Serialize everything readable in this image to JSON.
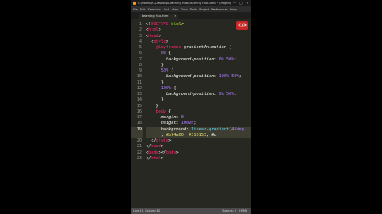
{
  "window": {
    "title": "C:\\Users\\PC\\Desktop\\Learning Hub\\Learning Hub.html • (Project) - Sublime Text",
    "minimize": "—",
    "maximize": "▢",
    "close": "✕"
  },
  "menu": [
    "File",
    "Edit",
    "Selection",
    "Find",
    "View",
    "Goto",
    "Tools",
    "Project",
    "Preferences",
    "Help"
  ],
  "tab": {
    "label": "Learning Hub.html",
    "close": "✕"
  },
  "logo_text": "</>",
  "editor": {
    "current_line": 19,
    "lines": [
      {
        "n": "1",
        "segs": [
          [
            "p",
            "<!"
          ],
          [
            "t",
            "DOCTYPE"
          ],
          [
            "a",
            " html"
          ],
          [
            "p",
            ">"
          ]
        ]
      },
      {
        "n": "2",
        "segs": [
          [
            "p",
            "<"
          ],
          [
            "t",
            "html"
          ],
          [
            "p",
            ">"
          ]
        ]
      },
      {
        "n": "3",
        "segs": [
          [
            "p",
            "<"
          ],
          [
            "t",
            "head"
          ],
          [
            "p",
            ">"
          ]
        ]
      },
      {
        "n": "4",
        "segs": [
          [
            "p",
            "  <"
          ],
          [
            "t",
            "style"
          ],
          [
            "p",
            ">"
          ]
        ]
      },
      {
        "n": "5",
        "segs": [
          [
            "p",
            "    "
          ],
          [
            "t",
            "@keyframes"
          ],
          [
            "p",
            " gradientAnimation {"
          ]
        ]
      },
      {
        "n": "6",
        "segs": [
          [
            "p",
            "      "
          ],
          [
            "n",
            "0%"
          ],
          [
            "p",
            " {"
          ]
        ]
      },
      {
        "n": "7",
        "segs": [
          [
            "p",
            "        "
          ],
          [
            "pr",
            "background-position"
          ],
          [
            "p",
            ": "
          ],
          [
            "n",
            "0% 50%"
          ],
          [
            "p",
            ";"
          ]
        ]
      },
      {
        "n": "8",
        "segs": [
          [
            "p",
            "      }"
          ]
        ]
      },
      {
        "n": "9",
        "segs": [
          [
            "p",
            "      "
          ],
          [
            "n",
            "50%"
          ],
          [
            "p",
            " {"
          ]
        ]
      },
      {
        "n": "10",
        "segs": [
          [
            "p",
            "        "
          ],
          [
            "pr",
            "background-position"
          ],
          [
            "p",
            ": "
          ],
          [
            "n",
            "100% 50%"
          ],
          [
            "p",
            ";"
          ]
        ]
      },
      {
        "n": "11",
        "segs": [
          [
            "p",
            "      }"
          ]
        ]
      },
      {
        "n": "12",
        "segs": [
          [
            "p",
            "      "
          ],
          [
            "n",
            "100%"
          ],
          [
            "p",
            " {"
          ]
        ]
      },
      {
        "n": "13",
        "segs": [
          [
            "p",
            "        "
          ],
          [
            "pr",
            "background-position"
          ],
          [
            "p",
            ": "
          ],
          [
            "n",
            "0% 50%"
          ],
          [
            "p",
            ";"
          ]
        ]
      },
      {
        "n": "14",
        "segs": [
          [
            "p",
            "      }"
          ]
        ]
      },
      {
        "n": "15",
        "segs": [
          [
            "p",
            "    }"
          ]
        ]
      },
      {
        "n": "16",
        "segs": [
          [
            "p",
            "    "
          ],
          [
            "t",
            "body"
          ],
          [
            "p",
            " {"
          ]
        ]
      },
      {
        "n": "17",
        "segs": [
          [
            "p",
            "      "
          ],
          [
            "pr",
            "margin"
          ],
          [
            "p",
            ": "
          ],
          [
            "n",
            "0"
          ],
          [
            "p",
            ";"
          ]
        ]
      },
      {
        "n": "18",
        "segs": [
          [
            "p",
            "      "
          ],
          [
            "pr",
            "height"
          ],
          [
            "p",
            ": "
          ],
          [
            "n",
            "100vh"
          ],
          [
            "p",
            ";"
          ]
        ]
      },
      {
        "n": "19",
        "segs": [
          [
            "p",
            "      "
          ],
          [
            "pr",
            "background"
          ],
          [
            "p",
            ": "
          ],
          [
            "f",
            "linear-gradient"
          ],
          [
            "p",
            "("
          ],
          [
            "n",
            "45deg"
          ]
        ]
      },
      {
        "n": "",
        "segs": [
          [
            "p",
            "      , "
          ],
          [
            "s",
            "#b94a00"
          ],
          [
            "p",
            ", "
          ],
          [
            "s",
            "#310153"
          ],
          [
            "p",
            ", #c"
          ]
        ]
      },
      {
        "n": "20",
        "segs": [
          [
            "p",
            "  </"
          ],
          [
            "t",
            "style"
          ],
          [
            "p",
            ">"
          ]
        ]
      },
      {
        "n": "21",
        "segs": [
          [
            "p",
            "</"
          ],
          [
            "t",
            "head"
          ],
          [
            "p",
            ">"
          ]
        ]
      },
      {
        "n": "22",
        "segs": [
          [
            "p",
            "<"
          ],
          [
            "t",
            "body"
          ],
          [
            "p",
            "></"
          ],
          [
            "t",
            "body"
          ],
          [
            "p",
            ">"
          ]
        ]
      },
      {
        "n": "23",
        "segs": [
          [
            "p",
            "</"
          ],
          [
            "t",
            "html"
          ],
          [
            "p",
            ">"
          ]
        ]
      }
    ]
  },
  "status": {
    "position": "Line 19, Column 82",
    "spaces": "Spaces: 2",
    "syntax": "HTML"
  },
  "colors": {
    "editor_bg": "#272822",
    "tag": "#f92672",
    "attribute": "#a6e22e",
    "number": "#ae81ff",
    "string": "#e6db74",
    "function": "#66d9ef",
    "logo": "#c62828"
  }
}
